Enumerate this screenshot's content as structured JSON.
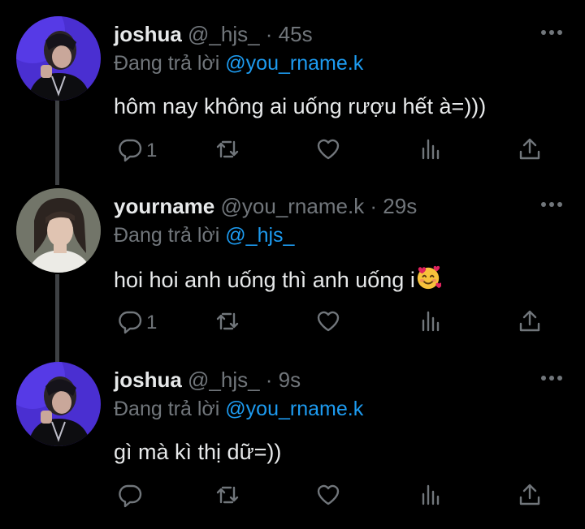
{
  "colors": {
    "background": "#000000",
    "text": "#e7e9ea",
    "muted": "#71767b",
    "accent": "#1d9bf0",
    "thread_line": "#3e4144"
  },
  "tweets": [
    {
      "name": "joshua",
      "meta": "@_hjs_ · 45s",
      "reply_prefix": "Đang trả lời",
      "reply_to": "@you_rname.k",
      "text": "hôm nay không ai uống rượu hết à=)))",
      "reply_count": "1",
      "avatar": "joshua-avatar"
    },
    {
      "name": "yourname",
      "meta": "@you_rname.k · 29s",
      "reply_prefix": "Đang trả lời",
      "reply_to": "@_hjs_",
      "text": "hoi hoi anh uống thì anh uống i",
      "emoji": "smiling-face-with-hearts",
      "reply_count": "1",
      "avatar": "yourname-avatar"
    },
    {
      "name": "joshua",
      "meta": "@_hjs_ · 9s",
      "reply_prefix": "Đang trả lời",
      "reply_to": "@you_rname.k",
      "text": "gì mà kì thị dữ=))",
      "reply_count": "",
      "avatar": "joshua-avatar"
    }
  ],
  "icons": [
    "reply-icon",
    "retweet-icon",
    "like-icon",
    "stats-icon",
    "share-icon",
    "more-icon"
  ]
}
